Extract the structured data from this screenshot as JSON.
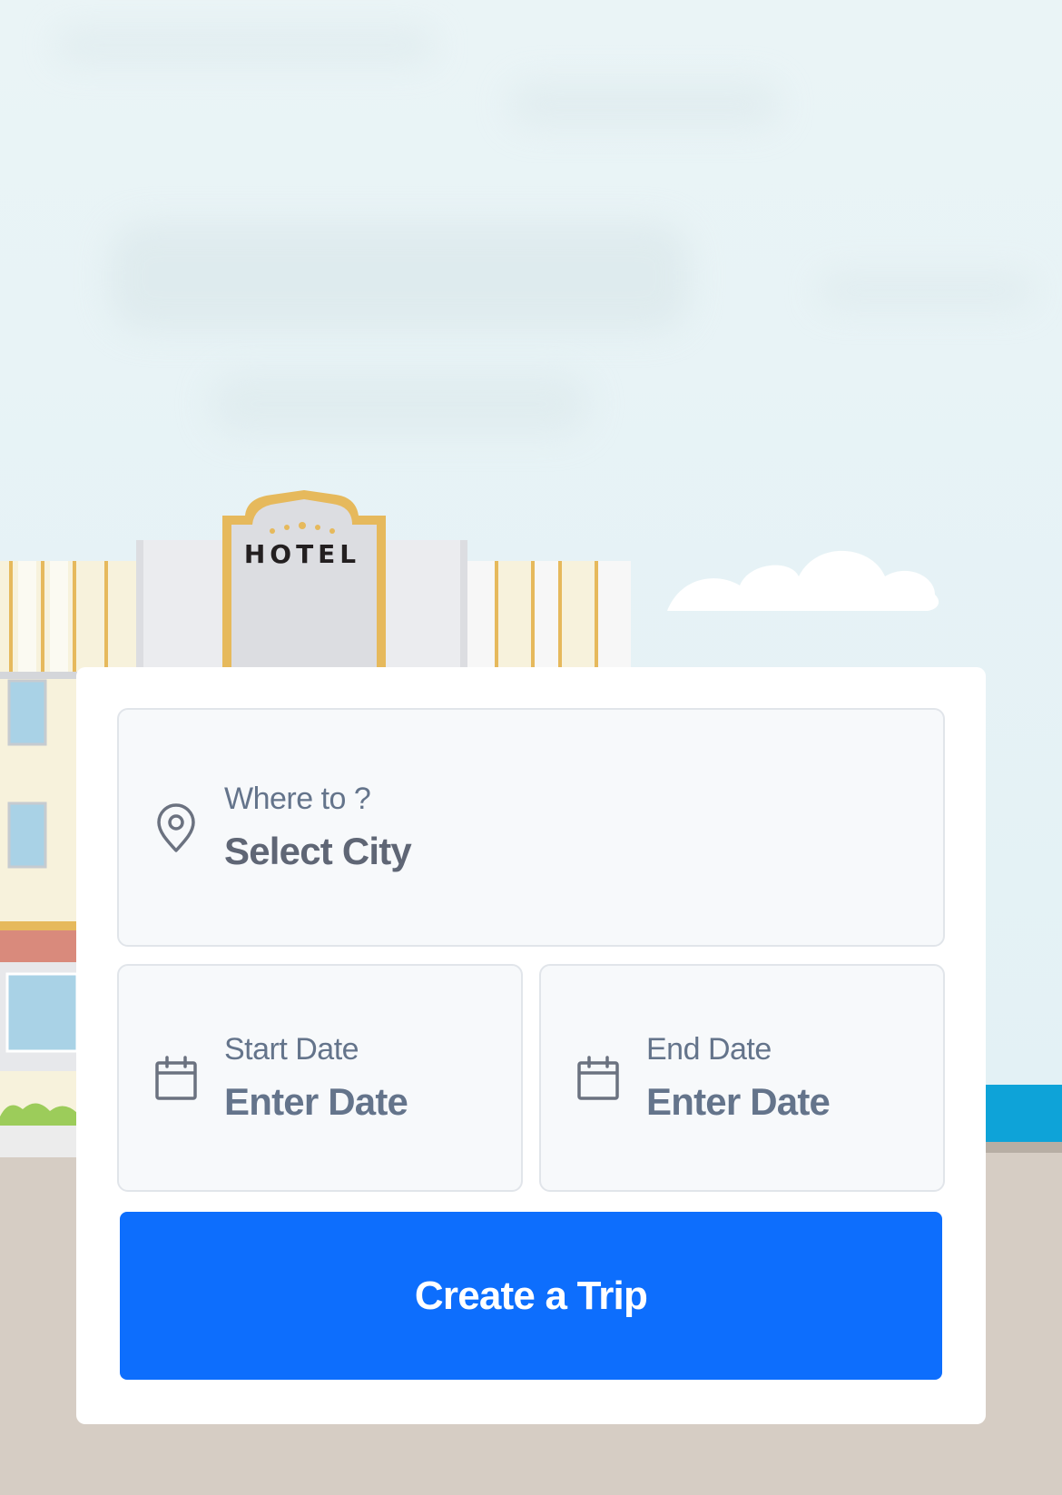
{
  "scene": {
    "sign_text": "HOTEL"
  },
  "form": {
    "destination": {
      "label": "Where to ?",
      "value": "Select City",
      "icon": "map-pin-icon"
    },
    "start_date": {
      "label": "Start Date",
      "value": "Enter Date",
      "icon": "calendar-icon"
    },
    "end_date": {
      "label": "End Date",
      "value": "Enter Date",
      "icon": "calendar-icon"
    },
    "submit_label": "Create a Trip"
  },
  "colors": {
    "primary": "#0d6efd",
    "text_muted": "#64748b",
    "field_bg": "#f7f9fb",
    "field_border": "#e1e5ea",
    "hotel_gold": "#e6b95c",
    "ground": "#d6cdc4",
    "sky": "#e8f4f7"
  }
}
